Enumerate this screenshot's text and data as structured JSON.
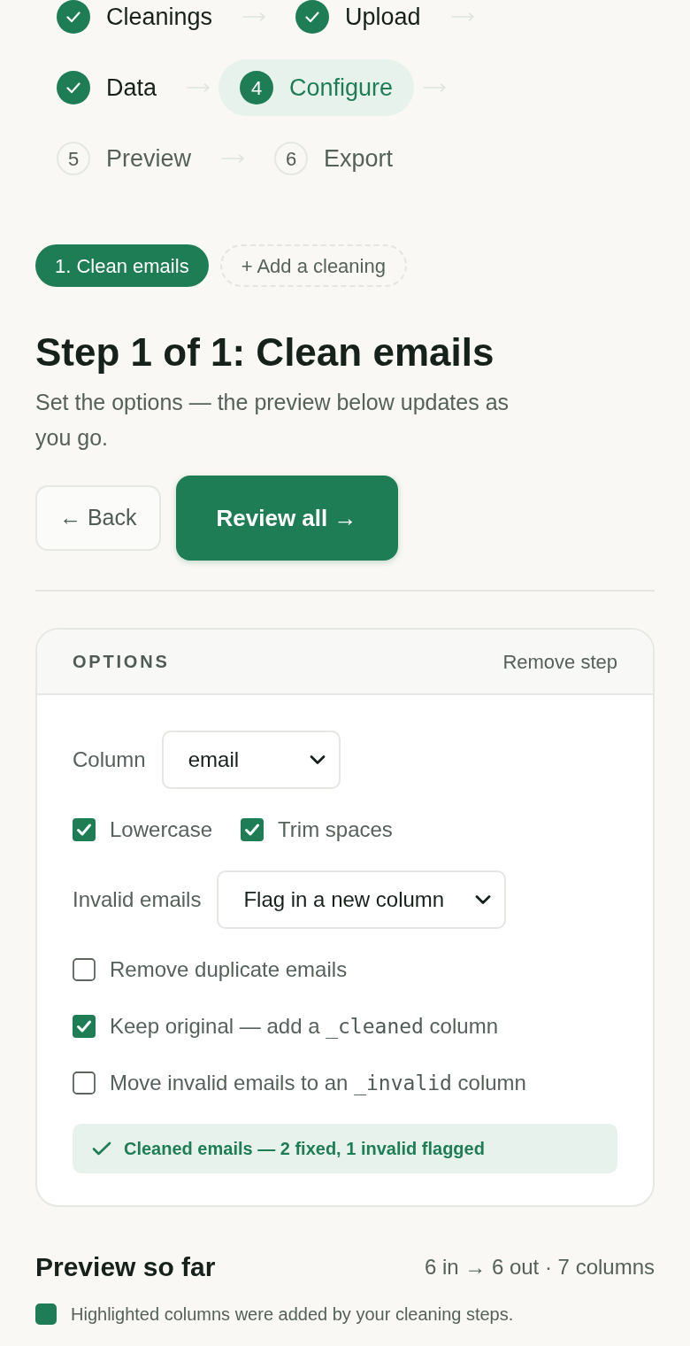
{
  "stepper": {
    "steps": [
      {
        "label": "Cleanings",
        "done": true,
        "selected": false
      },
      {
        "label": "Upload",
        "done": true,
        "selected": false
      },
      {
        "label": "Data",
        "done": true,
        "selected": false
      },
      {
        "label": "Configure",
        "number": "4",
        "done": false,
        "selected": true
      },
      {
        "label": "Preview",
        "number": "5",
        "done": false,
        "selected": false
      },
      {
        "label": "Export",
        "number": "6",
        "done": false,
        "selected": false
      }
    ]
  },
  "cleanings": {
    "items": [
      {
        "label": "1. Clean emails",
        "selected": true
      }
    ],
    "add_button": "+ Add a cleaning"
  },
  "step": {
    "heading": "Step 1 of 1: Clean emails",
    "subtitle": "Set the options — the preview below updates as you go.",
    "buttons": [
      {
        "label": "← Back",
        "kind": "secondary"
      },
      {
        "label": "Review all →",
        "kind": "primary"
      }
    ]
  },
  "options": {
    "title": "OPTIONS",
    "remove_link": "Remove step",
    "fields": [
      {
        "kind": "select",
        "label": "Column",
        "value": "email"
      },
      {
        "kind": "checks",
        "items": [
          {
            "checked": true,
            "parts": [
              {
                "kind": "text",
                "text": "Lowercase"
              }
            ]
          },
          {
            "checked": true,
            "parts": [
              {
                "kind": "text",
                "text": "Trim spaces"
              }
            ]
          }
        ]
      },
      {
        "kind": "select",
        "label": "Invalid emails",
        "value": "Flag in a new column"
      },
      {
        "kind": "checks",
        "items": [
          {
            "checked": false,
            "parts": [
              {
                "kind": "text",
                "text": "Remove duplicate emails"
              }
            ]
          }
        ]
      },
      {
        "kind": "checks",
        "items": [
          {
            "checked": true,
            "parts": [
              {
                "kind": "text",
                "text": "Keep original — add a "
              },
              {
                "kind": "code",
                "text": "_cleaned"
              },
              {
                "kind": "text",
                "text": " column"
              }
            ]
          }
        ]
      },
      {
        "kind": "checks",
        "items": [
          {
            "checked": false,
            "parts": [
              {
                "kind": "text",
                "text": "Move invalid emails to an "
              },
              {
                "kind": "code",
                "text": "_invalid"
              },
              {
                "kind": "text",
                "text": " column"
              }
            ]
          }
        ]
      }
    ],
    "status": "Cleaned emails — 2 fixed, 1 invalid flagged"
  },
  "preview": {
    "title": "Preview so far",
    "summary": "6 in → 6 out · 7 columns",
    "legend": "Highlighted columns were added by your cleaning steps."
  }
}
